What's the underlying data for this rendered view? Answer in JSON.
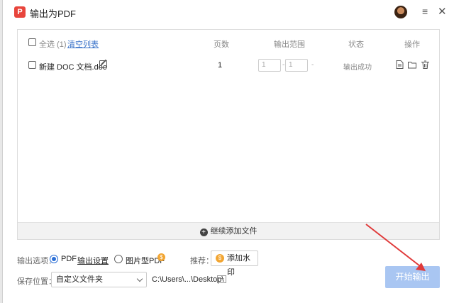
{
  "window": {
    "title": "输出为PDF",
    "app_icon_letter": "P"
  },
  "table": {
    "select_all_label": "全选 (1)",
    "clear_list_label": "清空列表",
    "columns": {
      "pages": "页数",
      "range": "输出范围",
      "status": "状态",
      "actions": "操作"
    },
    "rows": [
      {
        "filename": "新建 DOC 文档.doc",
        "pages": "1",
        "range_from": "1",
        "range_to": "1",
        "status": "输出成功"
      }
    ],
    "range_separator": "-",
    "status_separator": "-"
  },
  "add_more_label": "继续添加文件",
  "output_options": {
    "label": "输出选项：",
    "pdf_label": "PDF",
    "settings_label": "输出设置",
    "image_pdf_label": "图片型PDF",
    "vip_badge": "$",
    "selected": "PDF"
  },
  "recommend": {
    "label": "推荐：",
    "watermark_button": "添加水印"
  },
  "save": {
    "label": "保存位置：",
    "folder_option": "自定义文件夹",
    "path": "C:\\Users\\...\\Desktop\\",
    "more": "···"
  },
  "start_button": "开始输出",
  "colors": {
    "accent": "#2b6fd6",
    "start_button": "#a9c6f2",
    "brand": "#e8453c",
    "arrow": "#e03a3a"
  }
}
